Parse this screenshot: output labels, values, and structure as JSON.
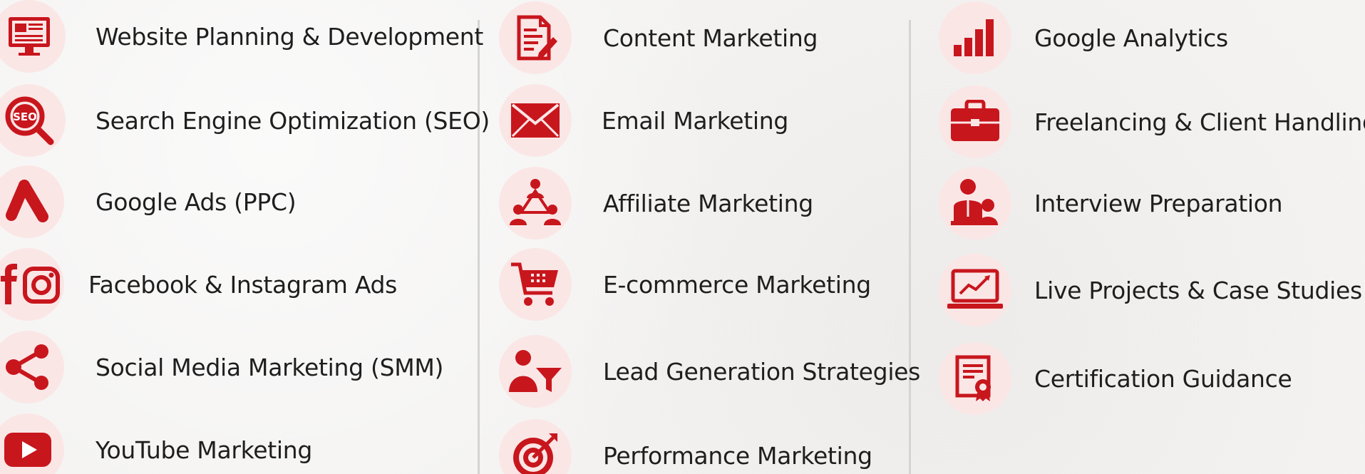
{
  "columns": [
    {
      "items": [
        {
          "label": "Website Planning & Development",
          "icon": "monitor-document-icon"
        },
        {
          "label": "Search Engine Optimization (SEO)",
          "icon": "seo-magnifier-icon"
        },
        {
          "label": "Google Ads (PPC)",
          "icon": "google-ads-icon"
        },
        {
          "label": "Facebook & Instagram Ads",
          "icon": "facebook-instagram-icon"
        },
        {
          "label": "Social Media Marketing (SMM)",
          "icon": "share-icon"
        },
        {
          "label": "YouTube Marketing",
          "icon": "youtube-icon"
        }
      ]
    },
    {
      "items": [
        {
          "label": "Content Marketing",
          "icon": "document-pen-icon"
        },
        {
          "label": "Email Marketing",
          "icon": "envelope-icon"
        },
        {
          "label": "Affiliate Marketing",
          "icon": "network-people-icon"
        },
        {
          "label": "E-commerce Marketing",
          "icon": "shopping-cart-icon"
        },
        {
          "label": "Lead Generation Strategies",
          "icon": "person-funnel-icon"
        },
        {
          "label": "Performance Marketing",
          "icon": "target-arrow-icon"
        }
      ]
    },
    {
      "items": [
        {
          "label": "Google Analytics",
          "icon": "bar-chart-icon"
        },
        {
          "label": "Freelancing & Client Handling",
          "icon": "briefcase-icon"
        },
        {
          "label": "Interview Preparation",
          "icon": "interview-icon"
        },
        {
          "label": "Live Projects & Case Studies",
          "icon": "laptop-chart-icon"
        },
        {
          "label": "Certification Guidance",
          "icon": "certificate-icon"
        }
      ]
    }
  ],
  "colors": {
    "accent": "#c8161d",
    "bubble": "#fbe6e6",
    "text": "#1e1e1e"
  }
}
